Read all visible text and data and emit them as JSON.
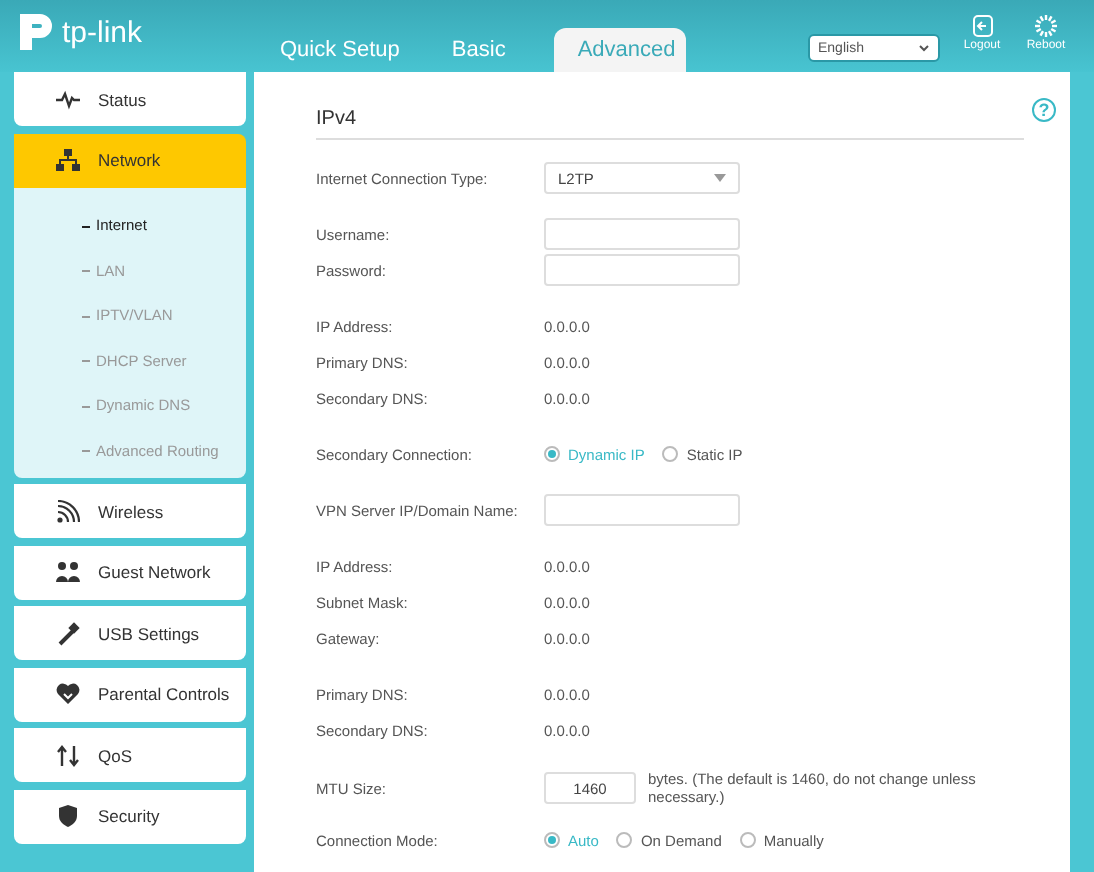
{
  "header": {
    "logo": "tp-link",
    "tabs": [
      {
        "label": "Quick Setup",
        "selected": false
      },
      {
        "label": "Basic",
        "selected": false
      },
      {
        "label": "Advanced",
        "selected": true
      }
    ],
    "language": "English",
    "actions": [
      {
        "kind": "logout",
        "label": "Logout"
      },
      {
        "kind": "reboot",
        "label": "Reboot"
      }
    ]
  },
  "sidebar": {
    "items": [
      {
        "label": "Status",
        "selected": false
      },
      {
        "label": "Network",
        "selected": true,
        "children": [
          {
            "label": "Internet",
            "selected": true
          },
          {
            "label": "LAN",
            "selected": false
          },
          {
            "label": "IPTV/VLAN",
            "selected": false
          },
          {
            "label": "DHCP Server",
            "selected": false
          },
          {
            "label": "Dynamic DNS",
            "selected": false
          },
          {
            "label": "Advanced Routing",
            "selected": false
          }
        ]
      },
      {
        "label": "Wireless",
        "selected": false
      },
      {
        "label": "Guest Network",
        "selected": false
      },
      {
        "label": "USB Settings",
        "selected": false
      },
      {
        "label": "Parental Controls",
        "selected": false
      },
      {
        "label": "QoS",
        "selected": false
      },
      {
        "label": "Security",
        "selected": false
      }
    ]
  },
  "panel": {
    "title": "IPv4",
    "help": "?",
    "groups": [
      [
        {
          "kind": "select",
          "label": "Internet Connection Type:",
          "value": "L2TP"
        }
      ],
      [
        {
          "kind": "input",
          "label": "Username:"
        },
        {
          "kind": "input",
          "label": "Password:"
        }
      ],
      [
        {
          "kind": "text",
          "label": "IP Address:",
          "value": "0.0.0.0"
        },
        {
          "kind": "text",
          "label": "Primary DNS:",
          "value": "0.0.0.0"
        },
        {
          "kind": "text",
          "label": "Secondary DNS:",
          "value": "0.0.0.0"
        }
      ],
      [
        {
          "kind": "radio",
          "label": "Secondary Connection:",
          "options": [
            {
              "label": "Dynamic IP",
              "selected": true
            },
            {
              "label": "Static IP",
              "selected": false
            }
          ]
        }
      ],
      [
        {
          "kind": "input",
          "label": "VPN Server IP/Domain Name:"
        }
      ],
      [
        {
          "kind": "text",
          "label": "IP Address:",
          "value": "0.0.0.0"
        },
        {
          "kind": "text",
          "label": "Subnet Mask:",
          "value": "0.0.0.0"
        },
        {
          "kind": "text",
          "label": "Gateway:",
          "value": "0.0.0.0"
        }
      ],
      [
        {
          "kind": "text",
          "label": "Primary DNS:",
          "value": "0.0.0.0"
        },
        {
          "kind": "text",
          "label": "Secondary DNS:",
          "value": "0.0.0.0"
        }
      ],
      [
        {
          "kind": "mtu",
          "label": "MTU Size:",
          "value": "1460",
          "note": "bytes. (The default is 1460, do not change unless necessary.)"
        }
      ],
      [
        {
          "kind": "radio",
          "label": "Connection Mode:",
          "options": [
            {
              "label": "Auto",
              "selected": true
            },
            {
              "label": "On Demand",
              "selected": false
            },
            {
              "label": "Manually",
              "selected": false
            }
          ]
        }
      ]
    ]
  }
}
